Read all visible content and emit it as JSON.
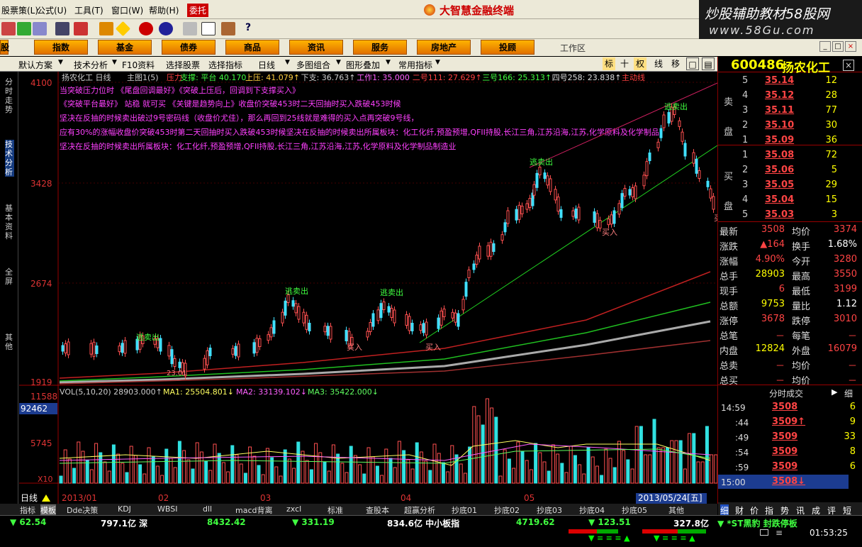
{
  "menu": [
    "股票策(L)",
    "公式(U)",
    "工具(T)",
    "窗口(W)",
    "帮助(H)",
    "委托"
  ],
  "app_title": "大智慧金融终端",
  "watermark": {
    "line1": "炒股辅助教材58股网",
    "line2": "www.58Gu.com"
  },
  "nav": [
    "股",
    "指数",
    "基金",
    "债券",
    "商品",
    "资讯",
    "服务",
    "房地产",
    "投顾"
  ],
  "nav_work": "工作区",
  "chart_toolbar": [
    "默认方案",
    "技术分析",
    "F10资料",
    "选择股票",
    "选择指标",
    "日线",
    "多图组合",
    "图形叠加",
    "常用指标"
  ],
  "chart_toolbar_right": [
    "标",
    "十",
    "权",
    "线",
    "移"
  ],
  "left_tabs": [
    "分时走势",
    "技术分析",
    "基本资料",
    "全屏",
    "其他"
  ],
  "chart": {
    "title": "扬农化工 日线",
    "indicator": "主图1(5)",
    "header_items": [
      {
        "text": "压力",
        "color": "#ff4040"
      },
      {
        "text": "支撑: 平台 40.170",
        "color": "#40ff40"
      },
      {
        "text": "上压: 41.079↑",
        "color": "#ffd040"
      },
      {
        "text": "下支: 36.763↑",
        "color": "#cccccc"
      },
      {
        "text": "工作1: 35.000",
        "color": "#ff60ff"
      },
      {
        "text": "二号111: 27.629↑",
        "color": "#ff4040"
      },
      {
        "text": "三号166: 25.313↑",
        "color": "#40ff40"
      },
      {
        "text": "四号258: 23.838↑",
        "color": "#dddddd"
      },
      {
        "text": "主动线",
        "color": "#ff4040"
      }
    ],
    "annotations": [
      "当突破压力位时 《尾盘回调最好》《突破上压后，回调到下支撑买入》",
      "《突破平台最好》 站稳 就可买 《关键是趋势向上》收盘价突破453时二天回抽时买入跌破453时候",
      "坚决在反抽的时候卖出破过9号密码线（收盘价尤佳），那么再回到25线就是难得的买入点再突破9号线，",
      "应有30%的涨幅收盘价突破453时第二天回抽时买入跌破453时候坚决在反抽的时候卖出所属板块：化工化纤,预盈预增,QFII持股,长江三角,江苏沿海,江苏,化学原料及化学制品",
      "坚决在反抽的时候卖出所属板块：化工化纤,预盈预增,QFII持股,长江三角,江苏沿海,江苏,化学原料及化学制品制造业"
    ],
    "price_axis": [
      "4100",
      "3428",
      "2674",
      "1919"
    ],
    "signals": [
      "逃卖出",
      "逃卖出",
      "逃卖出",
      "逃卖出",
      "逃卖出",
      "买入",
      "买入",
      "买入",
      "买入",
      "23.01"
    ],
    "vol_header": {
      "main": "VOL(5,10,20) 28903.000↑",
      "ma1": "MA1: 25504.801↓",
      "ma2": "MA2: 33139.102↓",
      "ma3": "MA3: 35422.000↓"
    },
    "vol_axis": [
      "11588",
      "92462",
      "5745",
      "X10"
    ],
    "date_axis": [
      "2013/01",
      "02",
      "03",
      "04",
      "05"
    ],
    "cursor_date": "2013/05/24[五]",
    "period_label": "日线"
  },
  "bottom_tabs": [
    "指标",
    "模板",
    "Dde决策",
    "KDJ",
    "WBSI",
    "dll",
    "macd背离",
    "zxcl",
    "标准",
    "查股本",
    "超赢分析",
    "抄底01",
    "抄底02",
    "抄底03",
    "抄底04",
    "抄底05",
    "其他"
  ],
  "quote": {
    "code": "600486",
    "name": "扬农化工",
    "sell_label": "卖盘",
    "buy_label": "买盘",
    "asks": [
      {
        "level": "5",
        "price": "35.14",
        "vol": "12"
      },
      {
        "level": "4",
        "price": "35.12",
        "vol": "28"
      },
      {
        "level": "3",
        "price": "35.11",
        "vol": "77"
      },
      {
        "level": "2",
        "price": "35.10",
        "vol": "30"
      },
      {
        "level": "1",
        "price": "35.09",
        "vol": "36"
      }
    ],
    "bids": [
      {
        "level": "1",
        "price": "35.08",
        "vol": "72"
      },
      {
        "level": "2",
        "price": "35.06",
        "vol": "5"
      },
      {
        "level": "3",
        "price": "35.05",
        "vol": "29"
      },
      {
        "level": "4",
        "price": "35.04",
        "vol": "15"
      },
      {
        "level": "5",
        "price": "35.03",
        "vol": "3"
      }
    ],
    "stats": [
      {
        "l": "最新",
        "v": "3508",
        "l2": "均价",
        "v2": "3374"
      },
      {
        "l": "涨跌",
        "v": "▲164",
        "l2": "换手",
        "v2": "1.68%"
      },
      {
        "l": "涨幅",
        "v": "4.90%",
        "l2": "今开",
        "v2": "3280"
      },
      {
        "l": "总手",
        "v": "28903",
        "l2": "最高",
        "v2": "3550"
      },
      {
        "l": "现手",
        "v": "6",
        "l2": "最低",
        "v2": "3199"
      },
      {
        "l": "总额",
        "v": "9753",
        "l2": "量比",
        "v2": "1.12"
      },
      {
        "l": "涨停",
        "v": "3678",
        "l2": "跌停",
        "v2": "3010"
      },
      {
        "l": "总笔",
        "v": "－",
        "l2": "每笔",
        "v2": "－"
      },
      {
        "l": "内盘",
        "v": "12824",
        "l2": "外盘",
        "v2": "16079"
      },
      {
        "l": "总卖",
        "v": "－",
        "l2": "均价",
        "v2": "－"
      },
      {
        "l": "总买",
        "v": "－",
        "l2": "均价",
        "v2": "－"
      }
    ],
    "ticks_header": "分时成交",
    "ticks_detail": "细",
    "ticks": [
      {
        "t": "14:59",
        "p": "3508",
        "v": "6",
        "a": ""
      },
      {
        "t": ":44",
        "p": "3509",
        "v": "9",
        "a": "↑"
      },
      {
        "t": ":49",
        "p": "3509",
        "v": "33",
        "a": ""
      },
      {
        "t": ":54",
        "p": "3509",
        "v": "8",
        "a": ""
      },
      {
        "t": ":59",
        "p": "3509",
        "v": "6",
        "a": ""
      },
      {
        "t": "15:00",
        "p": "3508",
        "v": "",
        "a": "↓"
      }
    ],
    "bottom_tabs": [
      "细",
      "财",
      "价",
      "指",
      "势",
      "讯",
      "成",
      "评",
      "短"
    ]
  },
  "status": [
    {
      "text": "▼ 62.54",
      "color": "#40ff40"
    },
    {
      "text": "797.1亿 深",
      "color": "#ffffff"
    },
    {
      "text": "8432.42",
      "color": "#40ff40"
    },
    {
      "text": "▼ 331.19",
      "color": "#40ff40"
    },
    {
      "text": "834.6亿 中小板指",
      "color": "#ffffff"
    },
    {
      "text": "4719.62",
      "color": "#40ff40"
    },
    {
      "text": "▼ 123.51",
      "color": "#40ff40"
    },
    {
      "text": "327.8亿",
      "color": "#ffffff"
    },
    {
      "text": "▼ *ST黑豹 封跌停板",
      "color": "#40ff40"
    }
  ],
  "clock": "01:53:25"
}
